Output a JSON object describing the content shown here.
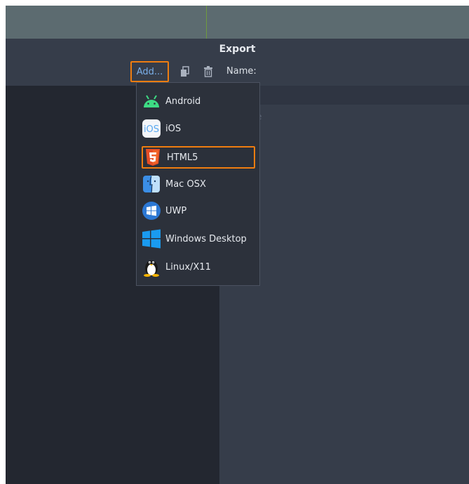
{
  "dialog": {
    "title": "Export"
  },
  "toolbar": {
    "add_label": "Add...",
    "name_label": "Name:",
    "icons": [
      "duplicate-icon",
      "delete-icon"
    ]
  },
  "right_panel": {
    "partial_text": "ble"
  },
  "add_menu": {
    "items": [
      {
        "label": "Android",
        "icon": "android-icon"
      },
      {
        "label": "iOS",
        "icon": "ios-icon"
      },
      {
        "label": "HTML5",
        "icon": "html5-icon",
        "highlighted": true
      },
      {
        "label": "Mac OSX",
        "icon": "macos-icon"
      },
      {
        "label": "UWP",
        "icon": "uwp-icon"
      },
      {
        "label": "Windows Desktop",
        "icon": "windows-icon"
      },
      {
        "label": "Linux/X11",
        "icon": "linux-icon"
      }
    ]
  },
  "colors": {
    "accent_highlight": "#ef7d10",
    "link_blue": "#7aaee8",
    "panel_dark": "#232730",
    "panel": "#363d4a"
  }
}
